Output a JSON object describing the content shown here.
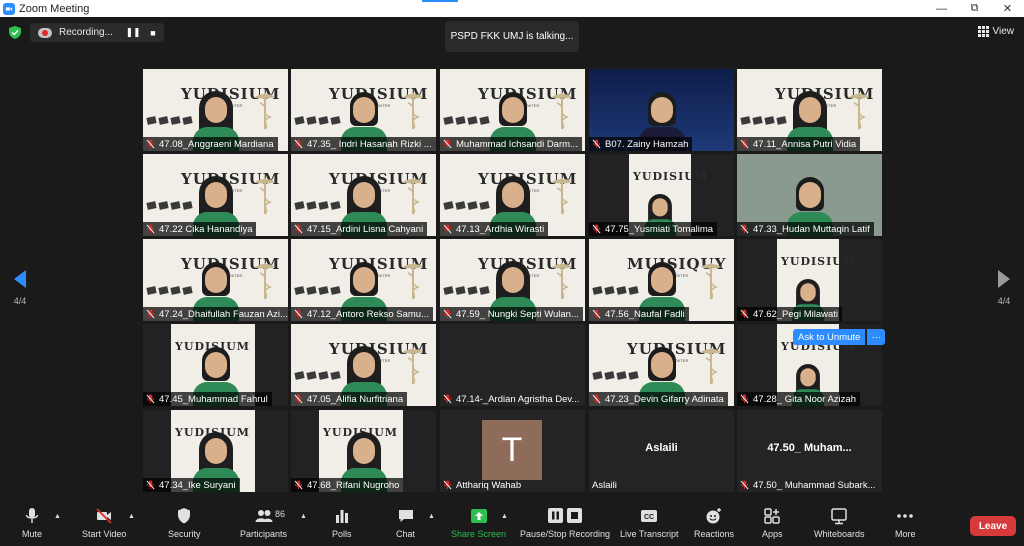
{
  "window": {
    "title": "Zoom Meeting",
    "buttons": [
      "—",
      "⧉",
      "✕"
    ]
  },
  "recording": {
    "label": "Recording...",
    "pause": "❚❚",
    "stop": "■"
  },
  "talking_banner": "PSPD FKK UMJ is talking...",
  "view_label": "View",
  "pagination": {
    "left": "4/4",
    "right": "4/4"
  },
  "ask_unmute": {
    "label": "Ask to Unmute",
    "more": "···"
  },
  "participants": [
    {
      "name": "47.08_Anggraeni Mardiana"
    },
    {
      "name": "47.35_ Indri Hasanah Rizki ..."
    },
    {
      "name": "Muhammad Ichsandi Darm..."
    },
    {
      "name": "B07.  Zainy Hamzah"
    },
    {
      "name": "47.11_Annisa Putri Vidia"
    },
    {
      "name": "47.22 Cika Hanandiya"
    },
    {
      "name": "47.15_Ardini Lisna Cahyani"
    },
    {
      "name": "47.13_Ardhia Wirasti"
    },
    {
      "name": "47.75_Yusmiati Tomalima"
    },
    {
      "name": "47.33_Hudan Muttaqin Latif"
    },
    {
      "name": "47.24_Dhaifullah Fauzan Azi..."
    },
    {
      "name": "47.12_Antoro Rekso Samu..."
    },
    {
      "name": "47.59_ Nungki Septi Wulan..."
    },
    {
      "name": "47.56_Naufal Fadli"
    },
    {
      "name": "47.62_Pegi Milawati"
    },
    {
      "name": "47.45_Muhammad Fahrul"
    },
    {
      "name": "47.05_Alifia Nurfitriana"
    },
    {
      "name": "47.14-_Ardian Agristha Dev..."
    },
    {
      "name": "47.23_Devin Gifarry Adinata"
    },
    {
      "name": "47.28_ Gita Noor Azizah"
    },
    {
      "name": "47.34_Ike Suryani"
    },
    {
      "name": "47.68_Rifani Nugroho"
    },
    {
      "name": "Atthariq Wahab",
      "avatar_letter": "T"
    },
    {
      "name": "Aslaili",
      "center_label": "Aslaili"
    },
    {
      "name": "47.50_ Muhammad Subark...",
      "center_label": "47.50_ Muham..."
    }
  ],
  "backdrop": {
    "title": "YUDISIUM",
    "subtitle": "PROFESI DOKTER",
    "alt_title": "MUISIQUY"
  },
  "toolbar": {
    "mute": "Mute",
    "start_video": "Start Video",
    "security": "Security",
    "participants": "Participants",
    "participants_count": "86",
    "polls": "Polls",
    "chat": "Chat",
    "share_screen": "Share Screen",
    "recording": "Pause/Stop Recording",
    "live_transcript": "Live Transcript",
    "cc": "CC",
    "reactions": "Reactions",
    "apps": "Apps",
    "whiteboards": "Whiteboards",
    "more": "More",
    "leave": "Leave"
  },
  "colors": {
    "accent": "#2d8cff",
    "leave": "#d63a3a",
    "share": "#2dbf4f",
    "mic_off": "#e02828"
  }
}
